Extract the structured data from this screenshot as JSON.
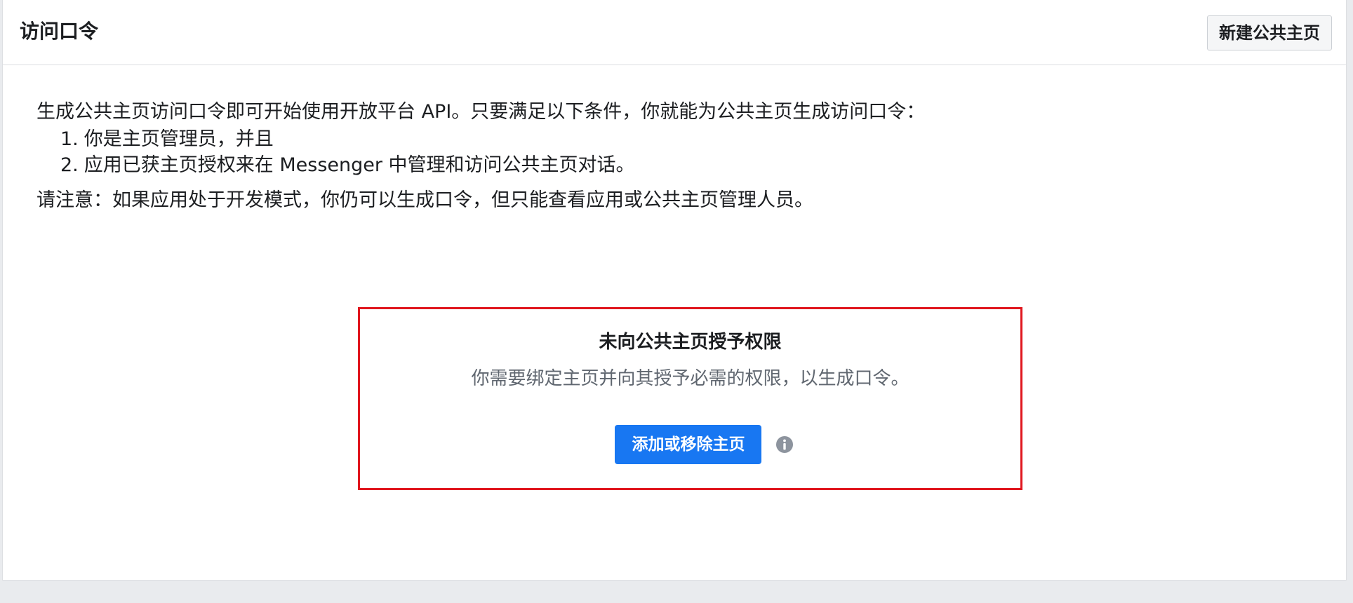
{
  "header": {
    "title": "访问口令",
    "new_page_button": "新建公共主页"
  },
  "content": {
    "intro": "生成公共主页访问口令即可开始使用开放平台 API。只要满足以下条件，你就能为公共主页生成访问口令：",
    "conditions": [
      {
        "num": "1.",
        "text": "你是主页管理员，并且"
      },
      {
        "num": "2.",
        "text": "应用已获主页授权来在 Messenger 中管理和访问公共主页对话。"
      }
    ],
    "note": "请注意：如果应用处于开发模式，你仍可以生成口令，但只能查看应用或公共主页管理人员。"
  },
  "permission_box": {
    "title": "未向公共主页授予权限",
    "description": "你需要绑定主页并向其授予必需的权限，以生成口令。",
    "button_label": "添加或移除主页",
    "info_icon": "info-icon",
    "border_color": "#e0161e"
  },
  "colors": {
    "primary_button": "#1877f2",
    "page_background": "#e9ebee",
    "secondary_text": "#606770"
  }
}
